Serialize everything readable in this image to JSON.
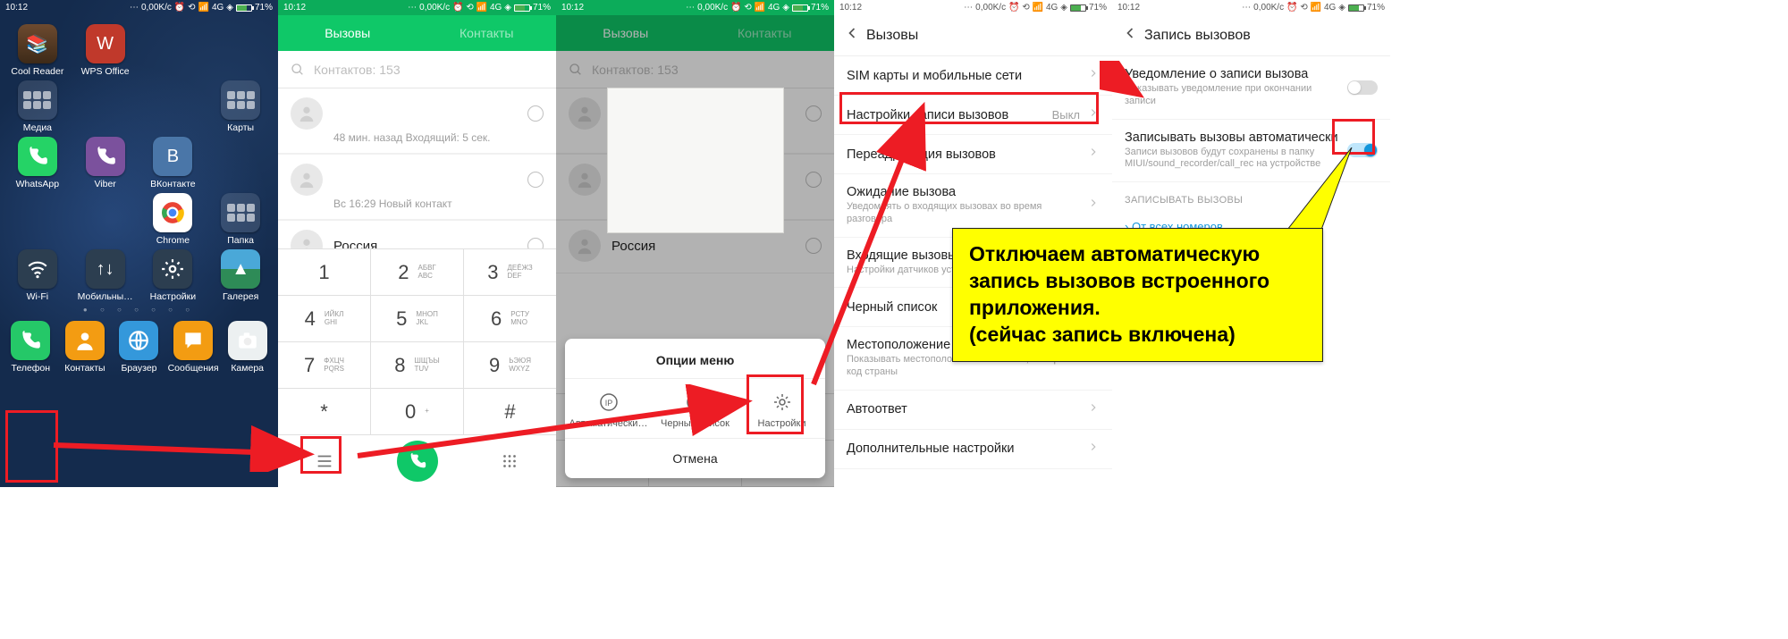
{
  "status": {
    "time": "10:12",
    "net": "0,00K/c",
    "sig": "4G",
    "battery": "71%"
  },
  "home": {
    "apps": [
      {
        "label": "Cool Reader",
        "cls": "ic-cool",
        "glyph": "📚"
      },
      {
        "label": "WPS Office",
        "cls": "ic-wps",
        "glyph": "W"
      },
      {
        "label": "Медиа",
        "cls": "ic-folder",
        "folder": true
      },
      {
        "label": "Карты",
        "cls": "ic-folder",
        "folder": true
      },
      {
        "label": "WhatsApp",
        "cls": "ic-wa",
        "svg": "phone"
      },
      {
        "label": "Viber",
        "cls": "ic-viber",
        "svg": "phone"
      },
      {
        "label": "ВКонтакте",
        "cls": "ic-vk",
        "glyph": "B"
      },
      {
        "label": "Chrome",
        "cls": "ic-chrome",
        "svg": "chrome"
      },
      {
        "label": "Папка",
        "cls": "ic-folder",
        "folder": true
      },
      {
        "label": "Wi-Fi",
        "cls": "ic-wifi",
        "svg": "wifi"
      },
      {
        "label": "Мобильны…",
        "cls": "ic-mob",
        "glyph": "↑↓"
      },
      {
        "label": "Настройки",
        "cls": "ic-set",
        "svg": "gear"
      },
      {
        "label": "Галерея",
        "cls": "ic-gal",
        "glyph": "▲"
      }
    ],
    "dock": [
      {
        "label": "Телефон",
        "cls": "ic-phone",
        "svg": "phone"
      },
      {
        "label": "Контакты",
        "cls": "ic-contacts",
        "svg": "person"
      },
      {
        "label": "Браузер",
        "cls": "ic-browser",
        "svg": "globe"
      },
      {
        "label": "Сообщения",
        "cls": "ic-msg",
        "svg": "msg"
      },
      {
        "label": "Камера",
        "cls": "ic-cam",
        "svg": "cam"
      }
    ]
  },
  "phone": {
    "tabs": {
      "calls": "Вызовы",
      "contacts": "Контакты"
    },
    "search_placeholder": "Контактов: 153",
    "recent": [
      {
        "name": " ",
        "sub": "48 мин. назад Входящий: 5 сек."
      },
      {
        "name": " ",
        "sub": "Вс 16:29 Новый контакт"
      },
      {
        "name": "Россия",
        "sub": ""
      }
    ],
    "keypad": [
      [
        [
          "1",
          ""
        ],
        [
          "2",
          "АБВГ\nABC"
        ],
        [
          "3",
          "ДЕЁЖЗ\nDEF"
        ]
      ],
      [
        [
          "4",
          "ИЙКЛ\nGHI"
        ],
        [
          "5",
          "МНОП\nJKL"
        ],
        [
          "6",
          "РСТУ\nMNO"
        ]
      ],
      [
        [
          "7",
          "ФХЦЧ\nPQRS"
        ],
        [
          "8",
          "ШЩЪЫ\nTUV"
        ],
        [
          "9",
          "ЬЭЮЯ\nWXYZ"
        ]
      ],
      [
        [
          "*",
          ""
        ],
        [
          "0",
          "+"
        ],
        [
          "#",
          ""
        ]
      ]
    ],
    "menu": {
      "title": "Опции меню",
      "items": [
        {
          "label": "Автоматически…",
          "icon": "ip"
        },
        {
          "label": "Черный список",
          "icon": "block"
        },
        {
          "label": "Настройки",
          "icon": "gear"
        }
      ],
      "cancel": "Отмена"
    }
  },
  "settings4": {
    "title": "Вызовы",
    "rows": [
      {
        "name": "SIM карты и мобильные сети"
      },
      {
        "name": "Настройки записи вызовов",
        "val": "Выкл"
      },
      {
        "name": "Переадресация вызовов"
      },
      {
        "name": "Ожидание вызова",
        "desc": "Уведомлять о входящих вызовах во время разговора"
      },
      {
        "name": "Входящие вызовы",
        "desc": "Настройки датчиков устройства при вызове"
      },
      {
        "name": "Черный список"
      },
      {
        "name": "Местоположение",
        "desc": "Показывать местоположение абонента, набирать код страны"
      },
      {
        "name": "Автоответ"
      },
      {
        "name": "Дополнительные настройки"
      }
    ]
  },
  "settings5": {
    "title": "Запись вызовов",
    "rows": [
      {
        "name": "Уведомление о записи вызова",
        "desc": "Показывать уведомление при окончании записи",
        "toggle": false
      },
      {
        "name": "Записывать вызовы автоматически",
        "desc": "Записи вызовов будут сохранены в папку MIUI/sound_recorder/call_rec на устройстве",
        "toggle": true
      }
    ],
    "section": "ЗАПИСЫВАТЬ ВЫЗОВЫ",
    "link": "От всех номеров"
  },
  "callout": "Отключаем автоматическую запись вызовов встроенного приложения.\n(сейчас запись включена)"
}
